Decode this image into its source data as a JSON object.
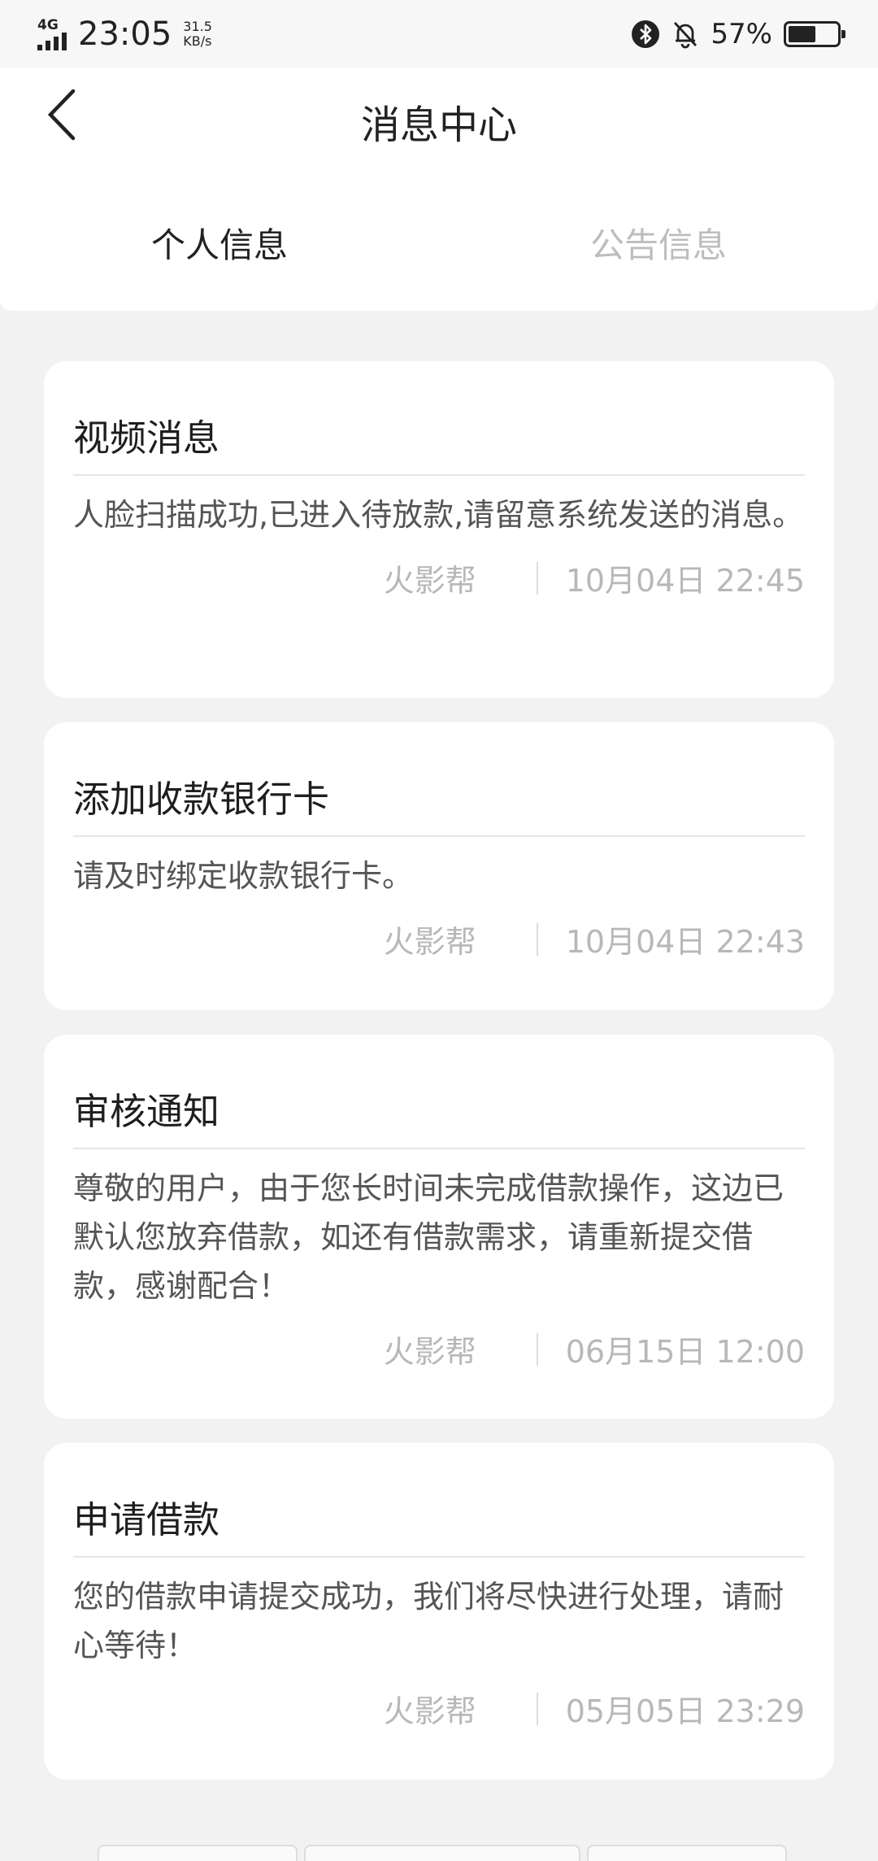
{
  "status_bar": {
    "network": "4G",
    "time": "23:05",
    "speed_value": "31.5",
    "speed_unit": "KB/s",
    "battery": "57%",
    "battery_level": 0.57
  },
  "header": {
    "title": "消息中心"
  },
  "tabs": [
    {
      "label": "个人信息",
      "active": true
    },
    {
      "label": "公告信息",
      "active": false
    }
  ],
  "messages": [
    {
      "title": "视频消息",
      "body": "人脸扫描成功,已进入待放款,请留意系统发送的消息。",
      "source": "火影帮",
      "datetime": "10月04日 22:45"
    },
    {
      "title": "添加收款银行卡",
      "body": "请及时绑定收款银行卡。",
      "source": "火影帮",
      "datetime": "10月04日 22:43"
    },
    {
      "title": "审核通知",
      "body": "尊敬的用户，由于您长时间未完成借款操作，这边已默认您放弃借款，如还有借款需求，请重新提交借款，感谢配合！",
      "source": "火影帮",
      "datetime": "06月15日 12:00"
    },
    {
      "title": "申请借款",
      "body": "您的借款申请提交成功，我们将尽快进行处理，请耐心等待！",
      "source": "火影帮",
      "datetime": "05月05日 23:29"
    }
  ]
}
